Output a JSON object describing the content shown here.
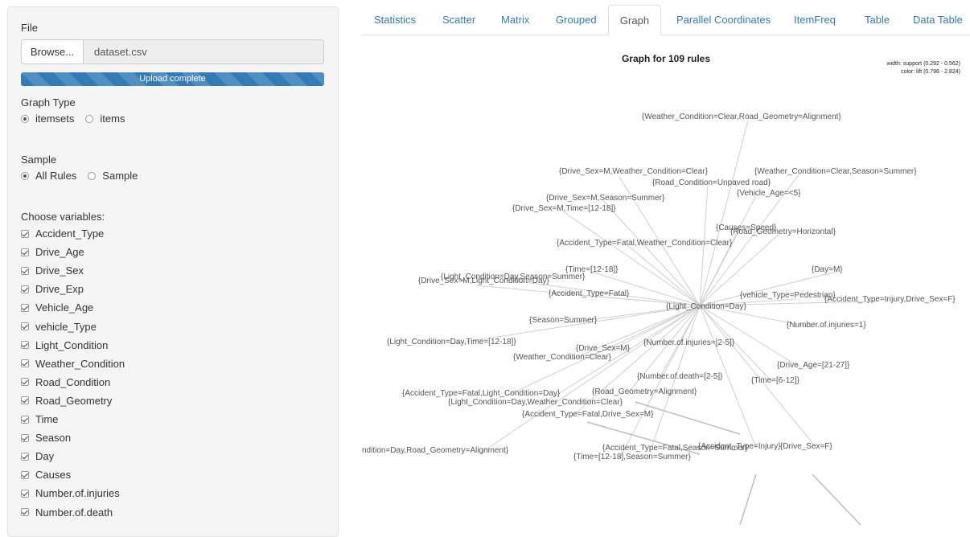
{
  "sidebar": {
    "file_label": "File",
    "browse_label": "Browse...",
    "file_name": "dataset.csv",
    "upload_status": "Upload complete",
    "upload_progress": 1.0,
    "graph_type": {
      "label": "Graph Type",
      "options": [
        "itemsets",
        "items"
      ],
      "selected": "itemsets"
    },
    "sample": {
      "label": "Sample",
      "options": [
        "All Rules",
        "Sample"
      ],
      "selected": "All Rules"
    },
    "variables": {
      "label": "Choose variables:",
      "items": [
        "Accident_Type",
        "Drive_Age",
        "Drive_Sex",
        "Drive_Exp",
        "Vehicle_Age",
        "vehicle_Type",
        "Light_Condition",
        "Weather_Condition",
        "Road_Condition",
        "Road_Geometry",
        "Time",
        "Season",
        "Day",
        "Causes",
        "Number.of.injuries",
        "Number.of.death"
      ]
    }
  },
  "tabs": [
    "Statistics",
    "Scatter",
    "Matrix",
    "Grouped",
    "Graph",
    "Parallel Coordinates",
    "ItemFreq",
    "Table",
    "Data Table"
  ],
  "active_tab": "Graph",
  "graph": {
    "title": "Graph for 109 rules",
    "legend_width": "width: support (0.292 - 0.562)",
    "legend_color": "color: lift (0.798 - 2.824)",
    "nodes": [
      "{Weather_Condition=Clear,Road_Geometry=Alignment}",
      "{Drive_Sex=M,Weather_Condition=Clear}",
      "{Weather_Condition=Clear,Season=Summer}",
      "{Road_Condition=Unpaved road}",
      "{Vehicle_Age=<5}",
      "{Drive_Sex=M,Season=Summer}",
      "{Drive_Sex=M,Time=[12-18]}",
      "{Causes=Speed}",
      "{Road_Geometry=Horizontal}",
      "{Accident_Type=Fatal,Weather_Condition=Clear}",
      "{Time=[12-18]}",
      "{Day=M}",
      "{Light_Condition=Day,Season=Summer}",
      "{Drive_Sex=M,Light_Condition=Day}",
      "{Accident_Type=Fatal}",
      "{vehicle_Type=Pedestrian}",
      "{Accident_Type=Injury,Drive_Sex=F}",
      "{Light_Condition=Day}",
      "{Season=Summer}",
      "{Number.of.injuries=1}",
      "{Light_Condition=Day,Time=[12-18]}",
      "{Number.of.injuries=[2-5]}",
      "{Drive_Sex=M}",
      "{Weather_Condition=Clear}",
      "{Drive_Age=[21-27]}",
      "{Number.of.death=[2-5]}",
      "{Time=[6-12]}",
      "{Accident_Type=Fatal,Light_Condition=Day}",
      "{Road_Geometry=Alignment}",
      "{Light_Condition=Day,Weather_Condition=Clear}",
      "{Accident_Type=Fatal,Drive_Sex=M}",
      "ndition=Day,Road_Geometry=Alignment}",
      "{Accident_Type=Fatal,Season=Summer}",
      "{Accident_Type=Injury}",
      "{Drive_Sex=F}",
      "{Time=[12-18],Season=Summer}"
    ]
  }
}
